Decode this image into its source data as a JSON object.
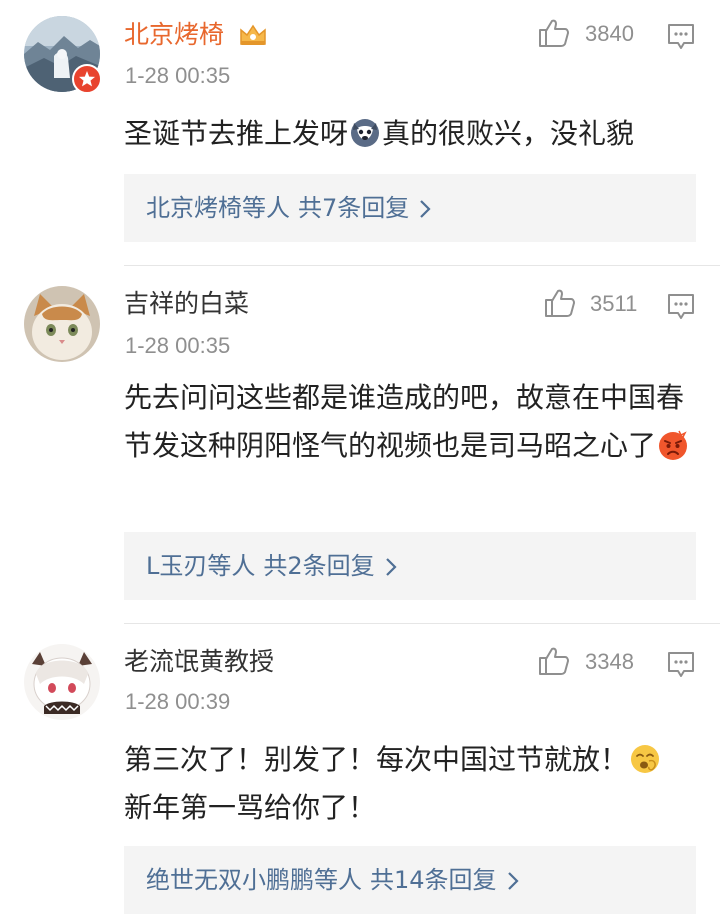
{
  "comments": [
    {
      "username": "北京烤椅",
      "time": "1-28 00:35",
      "likes": "3840",
      "text_before_emoji": "圣诞节去推上发呀",
      "emoji": "husky-face-emoji",
      "text_after_emoji": "真的很败兴，没礼貌",
      "reply_who": "北京烤椅等人",
      "reply_total": "共7条回复",
      "name_color": "#e8672d"
    },
    {
      "username": "吉祥的白菜",
      "time": "1-28 00:35",
      "likes": "3511",
      "text": "先去问问这些都是谁造成的吧，故意在中国春节发这种阴阳怪气的视频也是司马昭之心了",
      "emoji": "angry-face-emoji",
      "reply_who": "L玉刃等人",
      "reply_total": "共2条回复"
    },
    {
      "username": "老流氓黄教授",
      "time": "1-28 00:39",
      "likes": "3348",
      "text": "第三次了！别发了！每次中国过节就放！",
      "emoji": "yawning-face-emoji",
      "text_line2": "新年第一骂给你了！",
      "reply_who": "绝世无双小鹏鹏等人",
      "reply_total": "共14条回复"
    }
  ],
  "colors": {
    "link": "#4f6f95",
    "meta": "#8f8f8f",
    "vip_name": "#e8672d",
    "reply_box": "#f4f4f4"
  }
}
